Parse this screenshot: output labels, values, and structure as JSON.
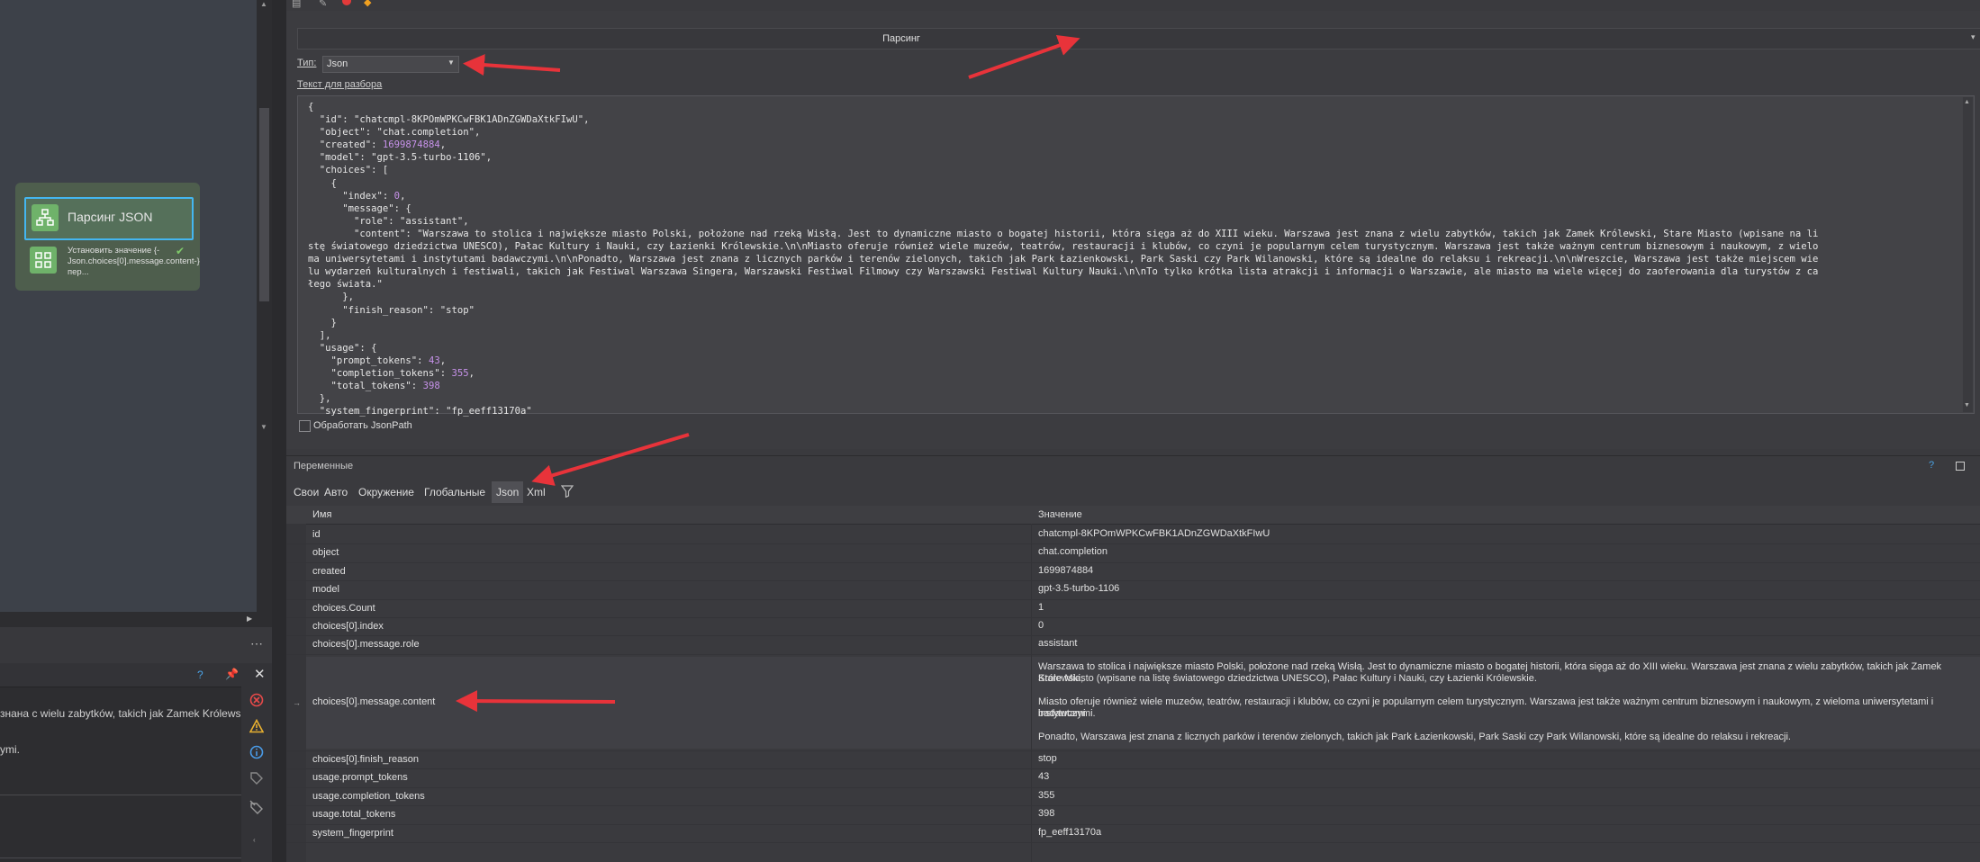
{
  "workflow": {
    "node_title": "Парсинг JSON",
    "sub_action_text": "Установить значение {-Json.choices[0].message.content-} пер..."
  },
  "log": {
    "lines": [
      "знана с wielu zabytków, takich jak Zamek Królewski,",
      "ymi."
    ]
  },
  "action": {
    "section_title": "Парсинг",
    "type_label": "Тип:",
    "type_value": "Json",
    "text_label": "Текст для разбора",
    "jsonpath_label": "Обработать JsonPath",
    "code_lines": [
      "{",
      "  \"id\": \"chatcmpl-8KPOmWPKCwFBK1ADnZGWDaXtkFIwU\",",
      "  \"object\": \"chat.completion\",",
      "  \"created\": 1699874884,",
      "  \"model\": \"gpt-3.5-turbo-1106\",",
      "  \"choices\": [",
      "    {",
      "      \"index\": 0,",
      "      \"message\": {",
      "        \"role\": \"assistant\",",
      "        \"content\": \"Warszawa to stolica i największe miasto Polski, położone nad rzeką Wisłą. Jest to dynamiczne miasto o bogatej historii, która sięga aż do XIII wieku. Warszawa jest znana z wielu zabytków, takich jak Zamek Królewski, Stare Miasto (wpisane na li",
      "stę światowego dziedzictwa UNESCO), Pałac Kultury i Nauki, czy Łazienki Królewskie.\\n\\nMiasto oferuje również wiele muzeów, teatrów, restauracji i klubów, co czyni je popularnym celem turystycznym. Warszawa jest także ważnym centrum biznesowym i naukowym, z wielo",
      "ma uniwersytetami i instytutami badawczymi.\\n\\nPonadto, Warszawa jest znana z licznych parków i terenów zielonych, takich jak Park Łazienkowski, Park Saski czy Park Wilanowski, które są idealne do relaksu i rekreacji.\\n\\nWreszcie, Warszawa jest także miejscem wie",
      "lu wydarzeń kulturalnych i festiwali, takich jak Festiwal Warszawa Singera, Warszawski Festiwal Filmowy czy Warszawski Festiwal Kultury Nauki.\\n\\nTo tylko krótka lista atrakcji i informacji o Warszawie, ale miasto ma wiele więcej do zaoferowania dla turystów z ca",
      "łego świata.\"",
      "      },",
      "      \"finish_reason\": \"stop\"",
      "    }",
      "  ],",
      "  \"usage\": {",
      "    \"prompt_tokens\": 43,",
      "    \"completion_tokens\": 355,",
      "    \"total_tokens\": 398",
      "  },",
      "  \"system_fingerprint\": \"fp_eeff13170a\""
    ]
  },
  "variables": {
    "title": "Переменные",
    "help": "?",
    "tabs": [
      "Свои",
      "Авто",
      "Окружение",
      "Глобальные",
      "Json",
      "Xml"
    ],
    "col_name": "Имя",
    "col_value": "Значение",
    "rows": [
      {
        "name": "id",
        "value": "chatcmpl-8KPOmWPKCwFBK1ADnZGWDaXtkFIwU"
      },
      {
        "name": "object",
        "value": "chat.completion"
      },
      {
        "name": "created",
        "value": "1699874884"
      },
      {
        "name": "model",
        "value": "gpt-3.5-turbo-1106"
      },
      {
        "name": "choices.Count",
        "value": "1"
      },
      {
        "name": "choices[0].index",
        "value": "0"
      },
      {
        "name": "choices[0].message.role",
        "value": "assistant"
      },
      {
        "name": "choices[0].message.content",
        "value_lines": [
          "Warszawa to stolica i największe miasto Polski, położone nad rzeką Wisłą. Jest to dynamiczne miasto o bogatej historii, która sięga aż do XIII wieku. Warszawa jest znana z wielu zabytków, takich jak Zamek Królewski,",
          "Stare Miasto (wpisane na listę światowego dziedzictwa UNESCO), Pałac Kultury i Nauki, czy Łazienki Królewskie.",
          "",
          "Miasto oferuje również wiele muzeów, teatrów, restauracji i klubów, co czyni je popularnym celem turystycznym. Warszawa jest także ważnym centrum biznesowym i naukowym, z wieloma uniwersytetami i instytutami",
          "badawczymi.",
          "",
          "Ponadto, Warszawa jest znana z licznych parków i terenów zielonych, takich jak Park Łazienkowski, Park Saski czy Park Wilanowski, które są idealne do relaksu i rekreacji."
        ]
      },
      {
        "name": "choices[0].finish_reason",
        "value": "stop"
      },
      {
        "name": "usage.prompt_tokens",
        "value": "43"
      },
      {
        "name": "usage.completion_tokens",
        "value": "355"
      },
      {
        "name": "usage.total_tokens",
        "value": "398"
      },
      {
        "name": "system_fingerprint",
        "value": "fp_eeff13170a"
      }
    ]
  },
  "colors": {
    "arrow": "#e8333a",
    "node_border": "#44b6f0",
    "node_icon": "#6fb26a",
    "number": "#c792ea"
  }
}
